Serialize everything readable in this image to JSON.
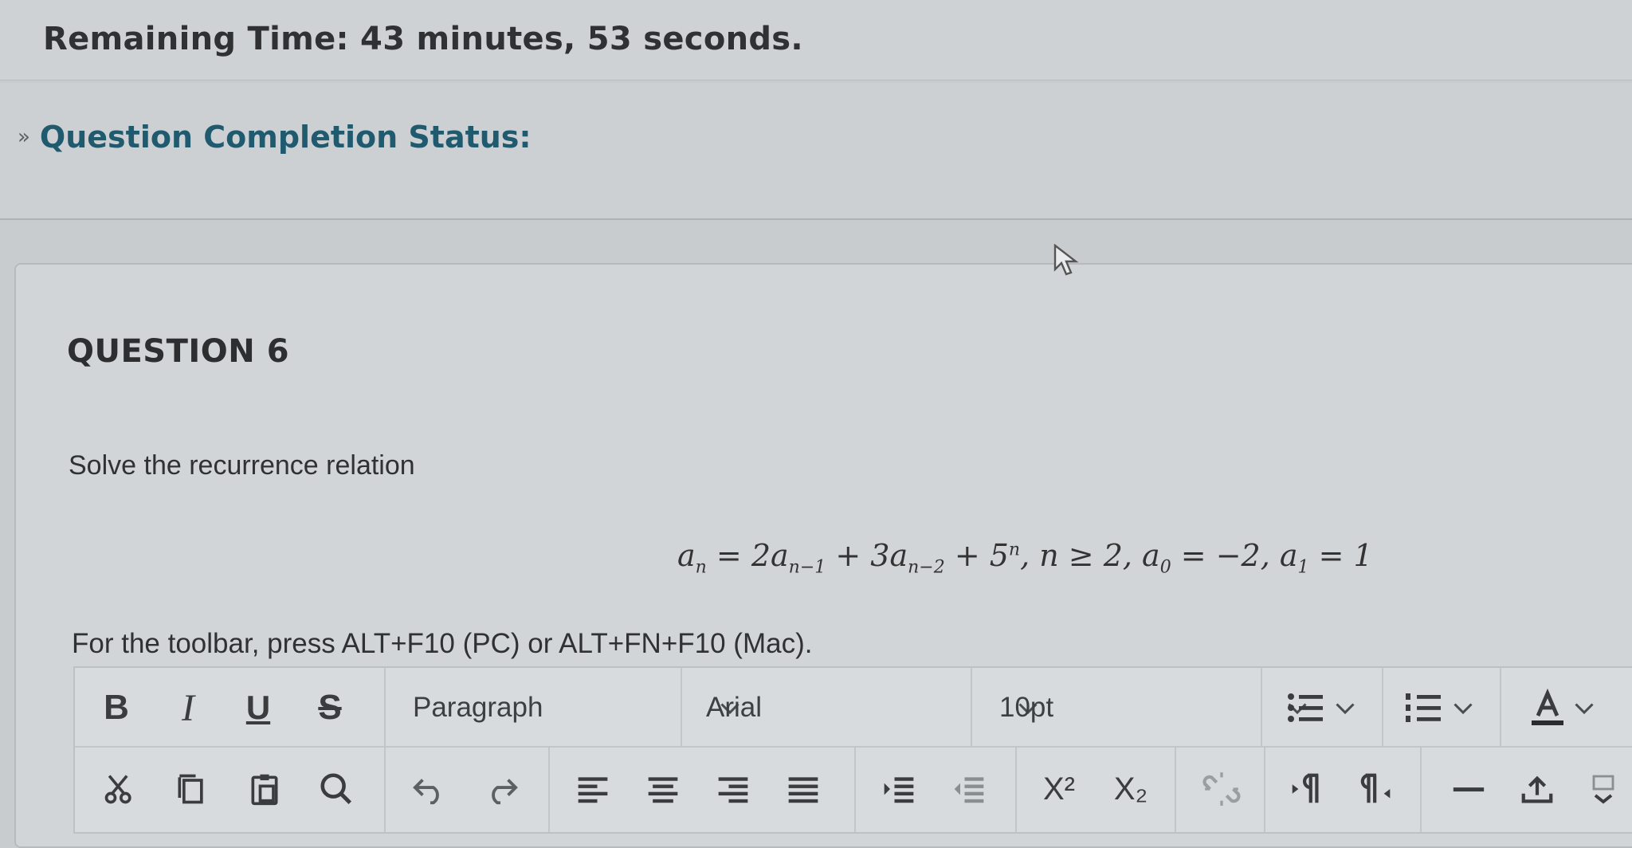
{
  "timer": {
    "text": "Remaining Time: 43 minutes, 53 seconds."
  },
  "status": {
    "label": "Question Completion Status:"
  },
  "question": {
    "title": "QUESTION 6",
    "prompt": "Solve the recurrence relation",
    "formula_text": "a_n = 2a_{n-1} + 3a_{n-2} + 5^n, n ≥ 2, a_0 = -2, a_1 = 1"
  },
  "editor": {
    "hint": "For the toolbar, press ALT+F10 (PC) or ALT+FN+F10 (Mac).",
    "bold_label": "B",
    "italic_label": "I",
    "underline_label": "U",
    "strike_label": "S",
    "paragraph_value": "Paragraph",
    "font_value": "Arial",
    "size_value": "10pt",
    "superscript_label": "X²",
    "subscript_label": "X₂",
    "icons": [
      "bold-icon",
      "italic-icon",
      "underline-icon",
      "strikethrough-icon",
      "bullet-list-icon",
      "numbered-list-icon",
      "text-color-icon",
      "cut-icon",
      "copy-icon",
      "paste-icon",
      "search-icon",
      "undo-icon",
      "redo-icon",
      "align-left-icon",
      "align-center-icon",
      "align-right-icon",
      "justify-icon",
      "indent-icon",
      "outdent-icon",
      "superscript-icon",
      "subscript-icon",
      "unlink-icon",
      "ltr-icon",
      "rtl-icon",
      "horizontal-rule-icon",
      "upload-icon"
    ]
  }
}
